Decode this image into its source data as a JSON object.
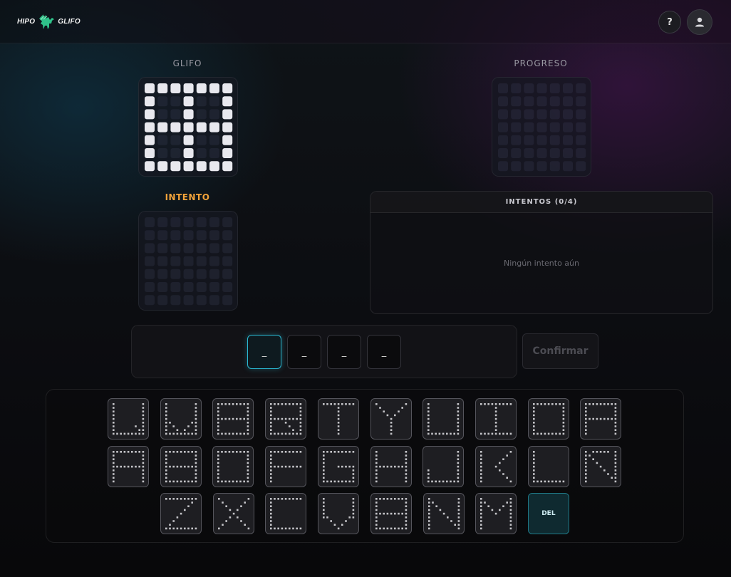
{
  "header": {
    "logo_left": "HIPO",
    "logo_right": "GLIFO",
    "logo_icon": "pegasus-icon",
    "help_label": "?",
    "user_icon": "user-icon"
  },
  "glifo": {
    "label": "GLIFO",
    "pattern": [
      "1111111",
      "1001001",
      "1001001",
      "1111111",
      "1001001",
      "1001001",
      "1111111"
    ]
  },
  "progreso": {
    "label": "PROGRESO"
  },
  "intento": {
    "label": "INTENTO"
  },
  "attempts": {
    "title": "INTENTOS (0/4)",
    "empty_text": "Ningún intento aún"
  },
  "input": {
    "slots": [
      "_",
      "_",
      "_",
      "_"
    ],
    "active_slot": 0,
    "confirm_label": "Confirmar"
  },
  "keyboard": {
    "del_label": "DEL",
    "rows": [
      [
        "Q",
        "W",
        "E",
        "R",
        "T",
        "Y",
        "U",
        "I",
        "O",
        "P"
      ],
      [
        "A",
        "S",
        "D",
        "F",
        "G",
        "H",
        "J",
        "K",
        "L",
        "Ñ"
      ],
      [
        "Z",
        "X",
        "C",
        "V",
        "B",
        "N",
        "M"
      ]
    ]
  },
  "colors": {
    "accent": "#2ab7d1",
    "intento_label": "#f2a33a",
    "pixel_on": "#e8e8ee",
    "key_dot": "#c4c4c8"
  }
}
